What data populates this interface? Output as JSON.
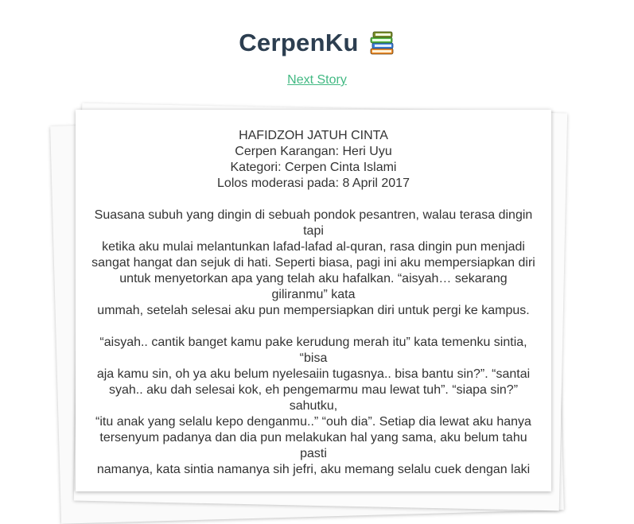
{
  "header": {
    "title": "CerpenKu",
    "icon": "books-icon",
    "next_link": "Next Story"
  },
  "story": {
    "title": "HAFIDZOH JATUH CINTA",
    "author_line": "Cerpen Karangan: Heri Uyu",
    "category_line": "Kategori: Cerpen Cinta Islami",
    "moderation_line": "Lolos moderasi pada: 8 April 2017",
    "lines": [
      "Suasana subuh yang dingin di sebuah pondok pesantren, walau terasa dingin tapi",
      "ketika aku mulai melantunkan lafad-lafad al-quran, rasa dingin pun menjadi",
      "sangat hangat dan sejuk di hati. Seperti biasa, pagi ini aku mempersiapkan diri",
      "untuk menyetorkan apa yang telah aku hafalkan. “aisyah… sekarang giliranmu” kata",
      "ummah, setelah selesai aku pun mempersiapkan diri untuk pergi ke kampus.",
      "",
      "“aisyah.. cantik banget kamu pake kerudung merah itu” kata temenku sintia, “bisa",
      "aja kamu sin, oh ya aku belum nyelesaiin tugasnya.. bisa bantu sin?”. “santai",
      "syah.. aku dah selesai kok, eh pengemarmu mau lewat tuh”. “siapa sin?” sahutku,",
      "“itu anak yang selalu kepo denganmu..” “ouh dia”. Setiap dia lewat aku hanya",
      "tersenyum padanya dan dia pun melakukan hal yang sama, aku belum tahu pasti",
      "namanya, kata sintia namanya sih jefri, aku memang selalu cuek dengan laki"
    ]
  },
  "colors": {
    "title": "#2c3e50",
    "link": "#42b983",
    "text": "#333333"
  }
}
